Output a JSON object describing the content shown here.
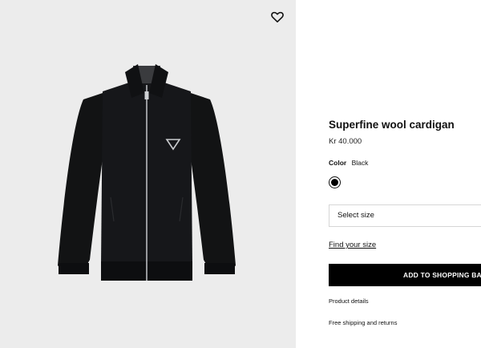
{
  "product": {
    "title": "Superfine wool cardigan",
    "price": "Kr 40.000",
    "color_label": "Color",
    "color_value": "Black",
    "swatch_color": "#000000"
  },
  "size_select": {
    "label": "Select size"
  },
  "links": {
    "find_size": "Find your size",
    "product_details": "Product details",
    "shipping": "Free shipping and returns"
  },
  "cart": {
    "add_label": "ADD TO SHOPPING BAG"
  },
  "icons": {
    "wishlist": "heart-icon"
  }
}
